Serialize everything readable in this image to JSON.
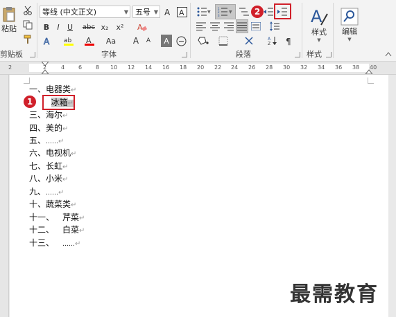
{
  "ribbon": {
    "paste_label": "粘贴",
    "clipboard_group": "剪贴板",
    "font_group": "字体",
    "paragraph_group": "段落",
    "styles_group": "样式",
    "font_name": "等线 (中文正文)",
    "font_size": "五号",
    "styles_button": "样式",
    "edit_button": "编辑",
    "bold": "B",
    "italic": "I",
    "underline": "U",
    "strike": "abc",
    "subscript": "x₂",
    "superscript": "x²",
    "char_border": "A",
    "grow_font": "A",
    "shrink_font": "A",
    "change_case": "Aa"
  },
  "ruler": {
    "ticks": [
      "2",
      "2",
      "4",
      "6",
      "8",
      "10",
      "12",
      "14",
      "16",
      "18",
      "20",
      "22",
      "24",
      "26",
      "28",
      "30",
      "32",
      "34",
      "36",
      "38",
      "40"
    ]
  },
  "document": {
    "lines": [
      {
        "num": "一、",
        "text": "电器类"
      },
      {
        "num": "1、",
        "text": "冰箱"
      },
      {
        "num": "三、",
        "text": "海尔"
      },
      {
        "num": "四、",
        "text": "美的"
      },
      {
        "num": "五、",
        "text": "……"
      },
      {
        "num": "六、",
        "text": "电视机"
      },
      {
        "num": "七、",
        "text": "长虹"
      },
      {
        "num": "八、",
        "text": "小米"
      },
      {
        "num": "九、",
        "text": "……"
      },
      {
        "num": "十、",
        "text": "蔬菜类"
      },
      {
        "num": "十一、",
        "text": "芹菜"
      },
      {
        "num": "十二、",
        "text": "白菜"
      },
      {
        "num": "十三、",
        "text": "……"
      }
    ]
  },
  "annotations": {
    "step1": "1",
    "step2": "2"
  },
  "watermark": "最需教育",
  "colors": {
    "annotation_red": "#d0202a",
    "accent_blue": "#2b579a"
  }
}
